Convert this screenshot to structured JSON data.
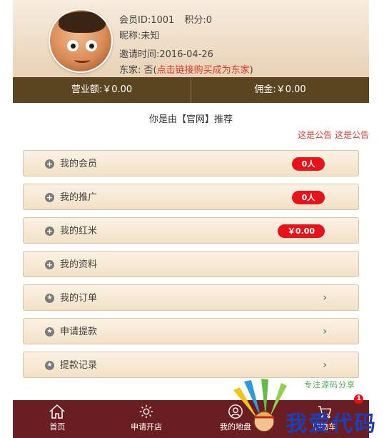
{
  "profile": {
    "member_id": "会员ID:1001",
    "points": "积分:0",
    "nickname": "昵称:未知",
    "invite_time": "邀请时间:2016-04-26",
    "dongjia_prefix": "东家:",
    "dongjia_status": "否(",
    "dongjia_link": "点击链接购买成为东家",
    "dongjia_suffix": ")"
  },
  "stats": {
    "revenue": "营业额:￥0.00",
    "commission": "佣金:￥0.00"
  },
  "recommend_text": "你是由【官网】推荐",
  "notice_text": "这是公告 这是公告",
  "menu": [
    {
      "label": "我的会员",
      "badge": "0人",
      "icon": "plus-circle-icon"
    },
    {
      "label": "我的推广",
      "badge": "0人",
      "icon": "plus-circle-icon"
    },
    {
      "label": "我的红米",
      "badge": "￥0.00",
      "icon": "plus-circle-icon"
    },
    {
      "label": "我的资料",
      "icon": "plus-circle-icon"
    },
    {
      "label": "我的订单",
      "chevron": "›",
      "icon": "star-circle-icon"
    },
    {
      "label": "申请提款",
      "chevron": "›",
      "icon": "star-circle-icon"
    },
    {
      "label": "提款记录",
      "chevron": "›",
      "icon": "star-circle-icon"
    }
  ],
  "bottom_nav": [
    {
      "label": "首页",
      "icon": "home-icon"
    },
    {
      "label": "申请开店",
      "icon": "gear-icon"
    },
    {
      "label": "我的地盘",
      "icon": "user-circle-icon"
    },
    {
      "label": "购物车",
      "icon": "cart-icon",
      "badge": "1"
    }
  ],
  "watermark": {
    "tagline": "专注源码分享",
    "brand": "我爱代码"
  },
  "colors": {
    "stats_bar": "#5b4420",
    "bottom_nav": "#6b1e22",
    "badge_red": "#e8121b",
    "link_red": "#d9392b"
  }
}
